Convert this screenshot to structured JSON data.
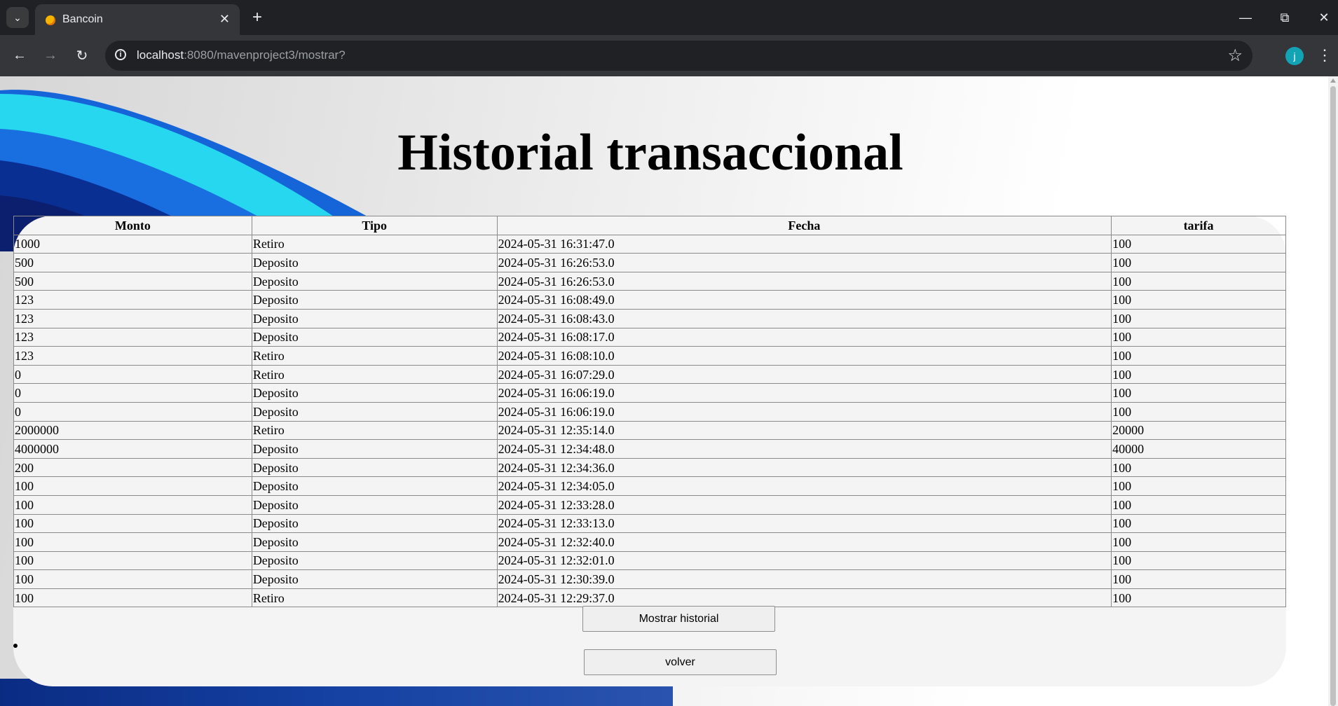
{
  "browser": {
    "tab_title": "Bancoin",
    "url_host": "localhost",
    "url_path": ":8080/mavenproject3/mostrar?",
    "profile_initial": "j"
  },
  "page": {
    "title": "Historial transaccional",
    "table": {
      "headers": [
        "Monto",
        "Tipo",
        "Fecha",
        "tarifa"
      ],
      "rows": [
        [
          "1000",
          "Retiro",
          "2024-05-31 16:31:47.0",
          "100"
        ],
        [
          "500",
          "Deposito",
          "2024-05-31 16:26:53.0",
          "100"
        ],
        [
          "500",
          "Deposito",
          "2024-05-31 16:26:53.0",
          "100"
        ],
        [
          "123",
          "Deposito",
          "2024-05-31 16:08:49.0",
          "100"
        ],
        [
          "123",
          "Deposito",
          "2024-05-31 16:08:43.0",
          "100"
        ],
        [
          "123",
          "Deposito",
          "2024-05-31 16:08:17.0",
          "100"
        ],
        [
          "123",
          "Retiro",
          "2024-05-31 16:08:10.0",
          "100"
        ],
        [
          "0",
          "Retiro",
          "2024-05-31 16:07:29.0",
          "100"
        ],
        [
          "0",
          "Deposito",
          "2024-05-31 16:06:19.0",
          "100"
        ],
        [
          "0",
          "Deposito",
          "2024-05-31 16:06:19.0",
          "100"
        ],
        [
          "2000000",
          "Retiro",
          "2024-05-31 12:35:14.0",
          "20000"
        ],
        [
          "4000000",
          "Deposito",
          "2024-05-31 12:34:48.0",
          "40000"
        ],
        [
          "200",
          "Deposito",
          "2024-05-31 12:34:36.0",
          "100"
        ],
        [
          "100",
          "Deposito",
          "2024-05-31 12:34:05.0",
          "100"
        ],
        [
          "100",
          "Deposito",
          "2024-05-31 12:33:28.0",
          "100"
        ],
        [
          "100",
          "Deposito",
          "2024-05-31 12:33:13.0",
          "100"
        ],
        [
          "100",
          "Deposito",
          "2024-05-31 12:32:40.0",
          "100"
        ],
        [
          "100",
          "Deposito",
          "2024-05-31 12:32:01.0",
          "100"
        ],
        [
          "100",
          "Deposito",
          "2024-05-31 12:30:39.0",
          "100"
        ],
        [
          "100",
          "Retiro",
          "2024-05-31 12:29:37.0",
          "100"
        ]
      ]
    },
    "buttons": {
      "show_history": "Mostrar historial",
      "back": "volver"
    }
  }
}
